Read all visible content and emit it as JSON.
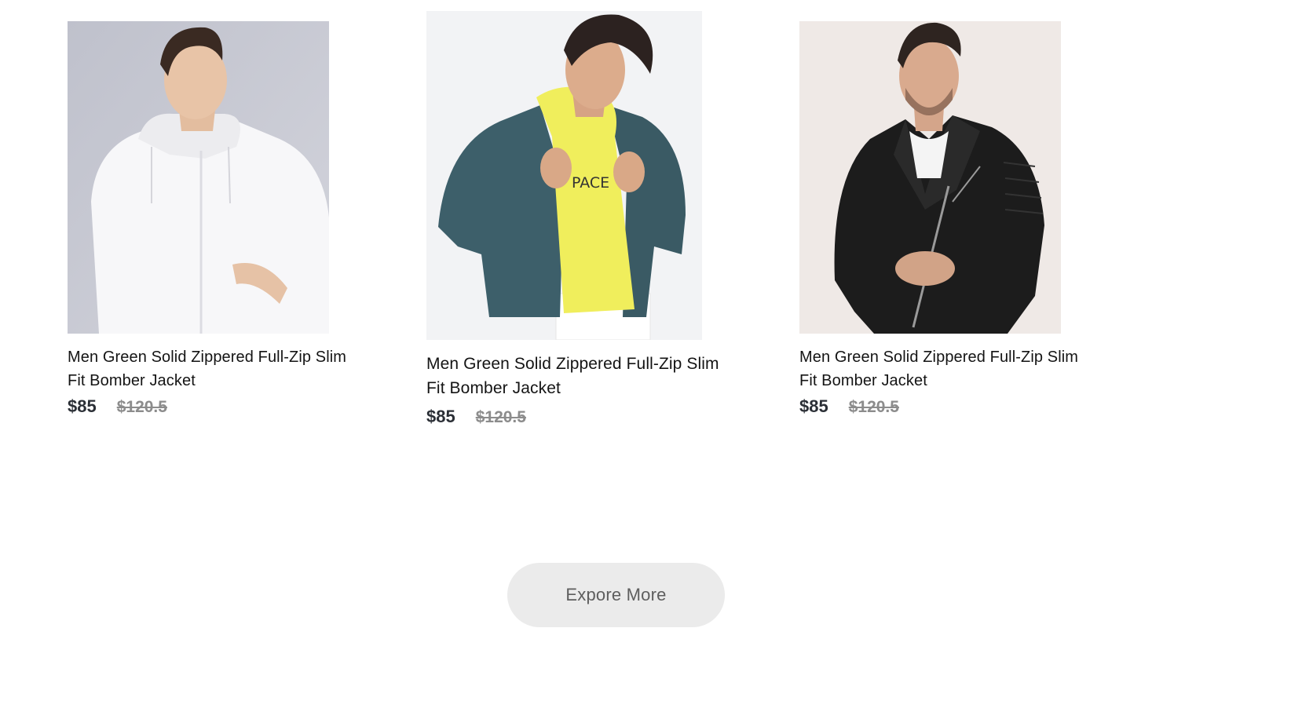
{
  "products": [
    {
      "title": "Men Green Solid Zippered Full-Zip Slim Fit Bomber Jacket",
      "price": "$85",
      "old_price": "$120.5",
      "bg_color": "#c9cad4",
      "icon": "white-hooded-jacket-photo"
    },
    {
      "title": "Men Green Solid Zippered Full-Zip Slim Fit Bomber Jacket",
      "price": "$85",
      "old_price": "$120.5",
      "bg_color": "#f1f2f4",
      "icon": "denim-jacket-yellow-hoodie-photo",
      "shirt_text": "PACE"
    },
    {
      "title": "Men Green Solid Zippered Full-Zip Slim Fit Bomber Jacket",
      "price": "$85",
      "old_price": "$120.5",
      "bg_color": "#efe9e6",
      "icon": "black-leather-biker-jacket-photo"
    }
  ],
  "explore_button": {
    "label": "Expore More"
  }
}
